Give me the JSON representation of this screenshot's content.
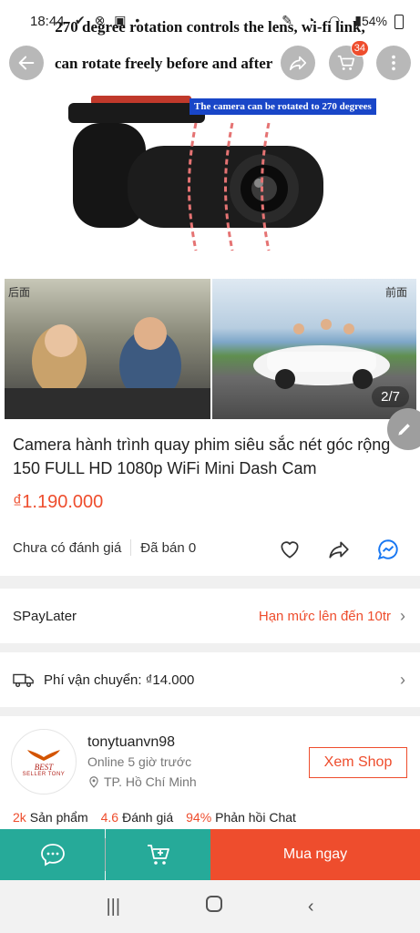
{
  "status_bar": {
    "time": "18:44",
    "battery": "54%"
  },
  "hero": {
    "caption_line1": "270 degree rotation controls the lens, wi-fi link,",
    "caption_line2": "can rotate freely before and after",
    "camera_note": "The camera can be rotated to 270 degrees",
    "tag_left": "后面",
    "tag_right": "前面",
    "counter": "2/7"
  },
  "top_actions": {
    "cart_badge": "34"
  },
  "product": {
    "title": "Camera hành trình quay phim siêu sắc nét góc rộng 150 FULL HD 1080p WiFi Mini Dash Cam",
    "price": "₫1.190.000",
    "rating_text": "Chưa có đánh giá",
    "sold_text": "Đã bán 0"
  },
  "spaylater": {
    "label": "SPayLater",
    "limit": "Hạn mức lên đến 10tr"
  },
  "shipping": {
    "label": "Phí vận chuyển: ₫14.000"
  },
  "shop": {
    "name": "tonytuanvn98",
    "online": "Online 5 giờ trước",
    "location": "TP. Hồ Chí Minh",
    "view_button": "Xem Shop",
    "logo_top": "BEST",
    "logo_bottom": "SELLER TONY",
    "stats": [
      {
        "value": "2k",
        "label": "Sản phẩm"
      },
      {
        "value": "4.6",
        "label": "Đánh giá"
      },
      {
        "value": "94%",
        "label": "Phản hồi Chat"
      }
    ]
  },
  "bottom_bar": {
    "buy_now": "Mua ngay"
  },
  "colors": {
    "accent": "#ee4d2d",
    "teal": "#26aa99"
  }
}
